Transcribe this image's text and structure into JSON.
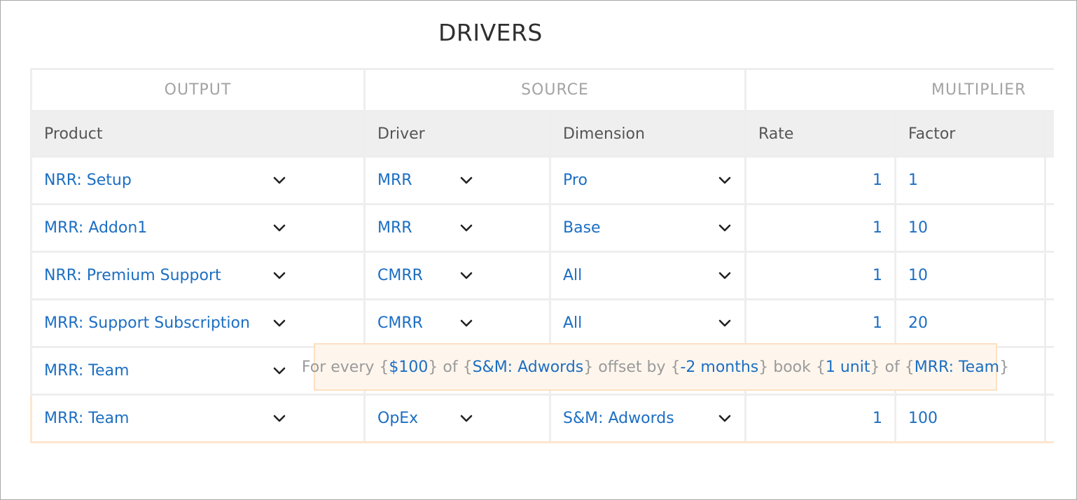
{
  "title": "DRIVERS",
  "groups": {
    "output": "OUTPUT",
    "source": "SOURCE",
    "multiplier": "MULTIPLIER"
  },
  "columns": {
    "product": "Product",
    "driver": "Driver",
    "dimension": "Dimension",
    "rate": "Rate",
    "factor": "Factor"
  },
  "rows": [
    {
      "product": "NRR: Setup",
      "driver": "MRR",
      "dimension": "Pro",
      "rate": "1",
      "factor": "1"
    },
    {
      "product": "MRR: Addon1",
      "driver": "MRR",
      "dimension": "Base",
      "rate": "1",
      "factor": "10"
    },
    {
      "product": "NRR: Premium Support",
      "driver": "CMRR",
      "dimension": "All",
      "rate": "1",
      "factor": "10"
    },
    {
      "product": "MRR: Support Subscription",
      "driver": "CMRR",
      "dimension": "All",
      "rate": "1",
      "factor": "20"
    },
    {
      "product": "MRR: Team",
      "driver": "",
      "dimension": "",
      "rate": "",
      "factor": ""
    },
    {
      "product": "MRR: Team",
      "driver": "OpEx",
      "dimension": "S&M: Adwords",
      "rate": "1",
      "factor": "100"
    }
  ],
  "tooltip": {
    "t1": "For every {",
    "v1": "$100",
    "t2": "} of {",
    "v2": "S&M: Adwords",
    "t3": "} offset by {",
    "v3": "-2 months",
    "t4": "} book {",
    "v4": "1 unit",
    "t5": "} of {",
    "v5": "MRR: Team",
    "t6": "}"
  },
  "icons": {
    "dropdown": "chevron-down-icon"
  },
  "colors": {
    "link": "#1c6ec3",
    "tooltip_bg": "#fef6ed",
    "tooltip_border": "#fde0c3",
    "header_bg": "#efefef"
  }
}
